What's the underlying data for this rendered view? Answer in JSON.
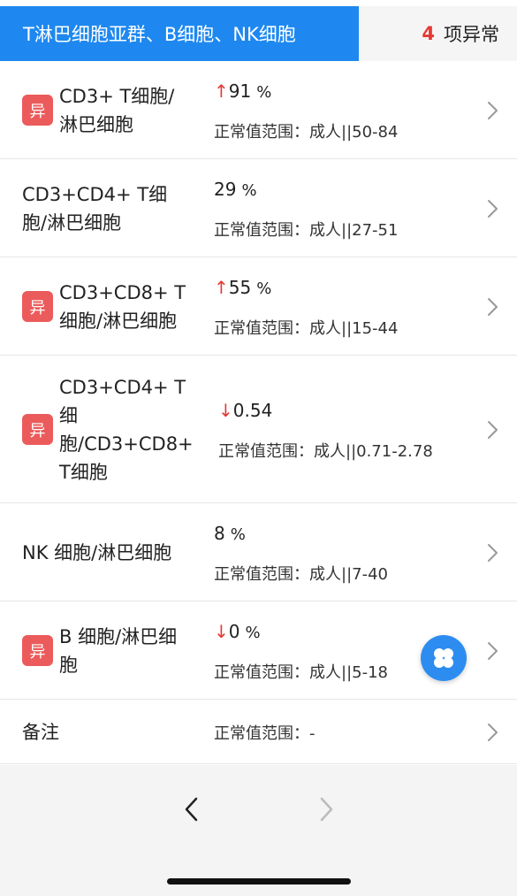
{
  "header": {
    "tab_label": "T淋巴细胞亚群、B细胞、NK细胞",
    "abnormal_count": "4",
    "abnormal_text": "项异常"
  },
  "colors": {
    "accent": "#1e88f0",
    "abnormal_red": "#e53935",
    "badge_red": "#ec5b5b"
  },
  "badge_label": "异",
  "range_prefix": "正常值范围：",
  "rows": [
    {
      "name_lines": [
        "CD3+ T细胞/",
        "淋巴细胞"
      ],
      "abnormal": true,
      "arrow": "↑",
      "value": "91",
      "unit": "%",
      "range": "成人||50-84"
    },
    {
      "name_lines": [
        "CD3+CD4+ T细",
        "胞/淋巴细胞"
      ],
      "abnormal": false,
      "arrow": "",
      "value": "29",
      "unit": "%",
      "range": "成人||27-51"
    },
    {
      "name_lines": [
        "CD3+CD8+ T",
        "细胞/淋巴细胞"
      ],
      "abnormal": true,
      "arrow": "↑",
      "value": "55",
      "unit": "%",
      "range": "成人||15-44"
    },
    {
      "name_lines": [
        "CD3+CD4+ T",
        "细",
        "胞/CD3+CD8+",
        "T细胞"
      ],
      "abnormal": true,
      "arrow": "↓",
      "value": "0.54",
      "unit": "",
      "range": "成人||0.71-2.78"
    },
    {
      "name_lines": [
        "NK 细胞/淋巴细胞"
      ],
      "abnormal": false,
      "arrow": "",
      "value": "8",
      "unit": "%",
      "range": "成人||7-40"
    },
    {
      "name_lines": [
        "B 细胞/淋巴细",
        "胞"
      ],
      "abnormal": true,
      "arrow": "↓",
      "value": "0",
      "unit": "%",
      "range": "成人||5-18"
    },
    {
      "name_lines": [
        "备注"
      ],
      "abnormal": false,
      "arrow": "",
      "value": "",
      "unit": "",
      "range": "-"
    }
  ]
}
